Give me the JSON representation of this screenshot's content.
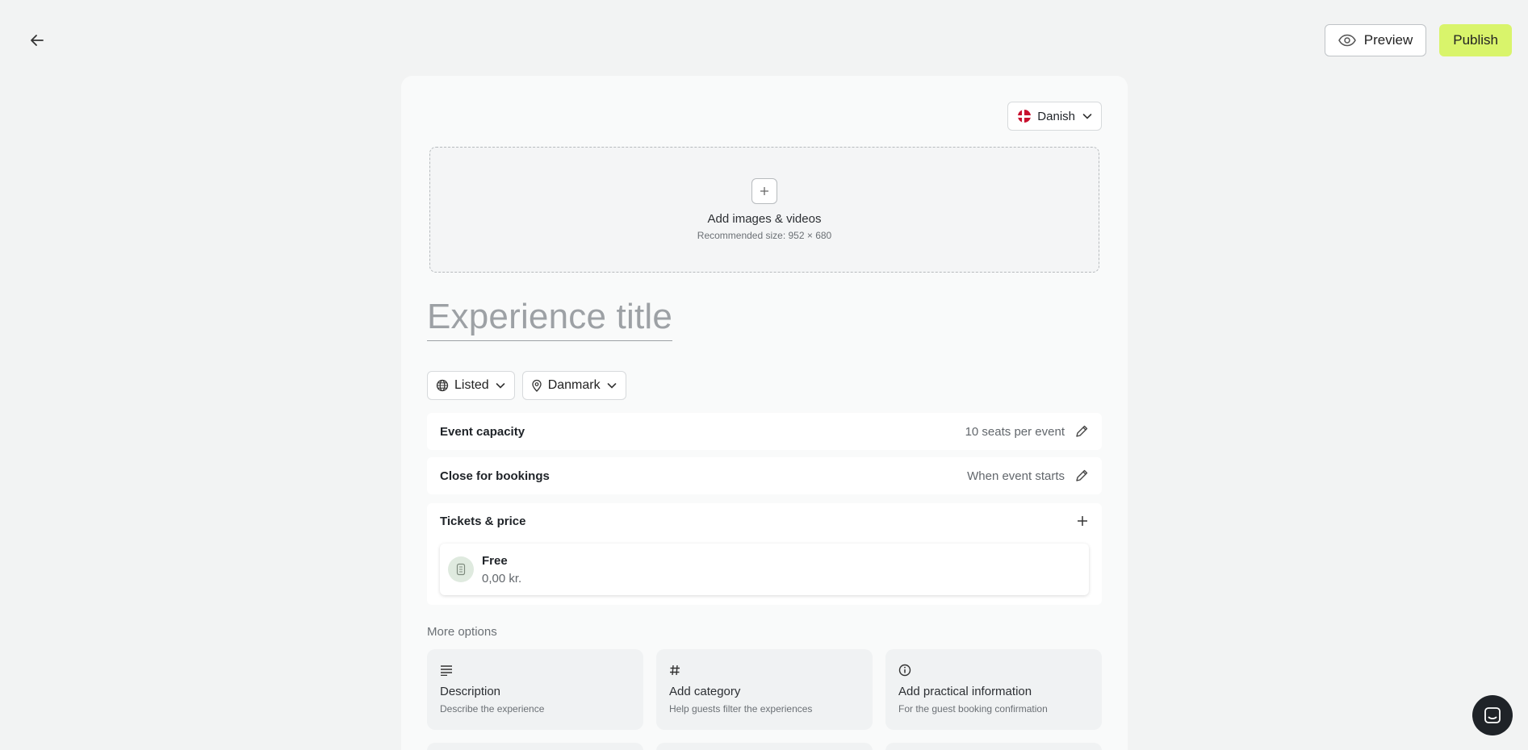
{
  "header": {
    "back_icon": "arrow-left-icon",
    "preview_label": "Preview",
    "publish_label": "Publish",
    "publish_color": "#d9f46b"
  },
  "language": {
    "selected": "Danish",
    "flag": "denmark-flag-icon"
  },
  "media": {
    "title": "Add images & videos",
    "subtitle": "Recommended size: 952 × 680"
  },
  "experience": {
    "title_placeholder": "Experience title"
  },
  "filters": {
    "visibility": "Listed",
    "location": "Danmark"
  },
  "settings": [
    {
      "label": "Event capacity",
      "value": "10 seats per event"
    },
    {
      "label": "Close for bookings",
      "value": "When event starts"
    }
  ],
  "tickets": {
    "label": "Tickets & price",
    "items": [
      {
        "name": "Free",
        "price": "0,00 kr."
      }
    ]
  },
  "more_options": {
    "label": "More options",
    "items": [
      {
        "icon": "lines-icon",
        "title": "Description",
        "subtitle": "Describe the experience"
      },
      {
        "icon": "hash-icon",
        "title": "Add category",
        "subtitle": "Help guests filter the experiences"
      },
      {
        "icon": "info-icon",
        "title": "Add practical information",
        "subtitle": "For the guest booking confirmation"
      }
    ]
  }
}
